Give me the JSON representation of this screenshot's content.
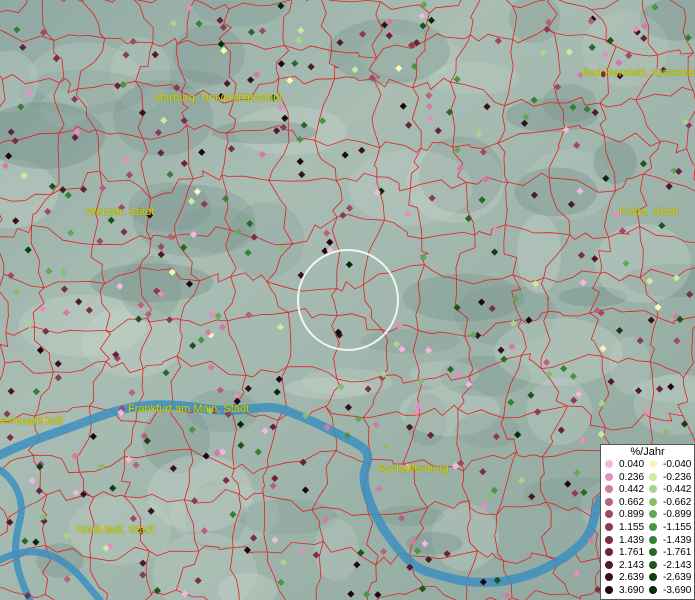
{
  "cities": [
    {
      "name": "Marburg, Universitätsstadt"
    },
    {
      "name": "Bad Hersfeld, Kreisstadt"
    },
    {
      "name": "Wetzlar, Stadt"
    },
    {
      "name": "Fulda, Stadt"
    },
    {
      "name": "Frankfurt am Main, Stadt"
    },
    {
      "name": "Wiesbaden, Landeshauptstadt",
      "visible_text": "eshauptstadt"
    },
    {
      "name": "Aschaffenburg"
    },
    {
      "name": "Riedstadt, Stadt"
    }
  ],
  "legend": {
    "title": "%/Jahr",
    "positive": [
      {
        "value": "0.040",
        "color": "#f4b6dc"
      },
      {
        "value": "0.236",
        "color": "#e48fc0"
      },
      {
        "value": "0.442",
        "color": "#d37aa6"
      },
      {
        "value": "0.662",
        "color": "#b9607f"
      },
      {
        "value": "0.899",
        "color": "#a04866"
      },
      {
        "value": "1.155",
        "color": "#8c3a55"
      },
      {
        "value": "1.439",
        "color": "#7a2e47"
      },
      {
        "value": "1.761",
        "color": "#66233a"
      },
      {
        "value": "2.143",
        "color": "#4e1a2c"
      },
      {
        "value": "2.639",
        "color": "#3a1020"
      },
      {
        "value": "3.690",
        "color": "#1c0810"
      }
    ],
    "negative": [
      {
        "value": "-0.040",
        "color": "#f3f9b9"
      },
      {
        "value": "-0.236",
        "color": "#cde9a2"
      },
      {
        "value": "-0.442",
        "color": "#a9d58a"
      },
      {
        "value": "-0.662",
        "color": "#85bf6e"
      },
      {
        "value": "-0.899",
        "color": "#63a955"
      },
      {
        "value": "-1.155",
        "color": "#4a9443"
      },
      {
        "value": "-1.439",
        "color": "#377f35"
      },
      {
        "value": "-1.761",
        "color": "#276a28"
      },
      {
        "value": "-2.143",
        "color": "#1a551c"
      },
      {
        "value": "-2.639",
        "color": "#0f3f12"
      },
      {
        "value": "-3.690",
        "color": "#062a08"
      }
    ]
  },
  "colors": {
    "border_lines": "#e02020",
    "water": "#3d8fc0",
    "city_label": "#d6d600",
    "highlight_circle": "#ffffff"
  }
}
